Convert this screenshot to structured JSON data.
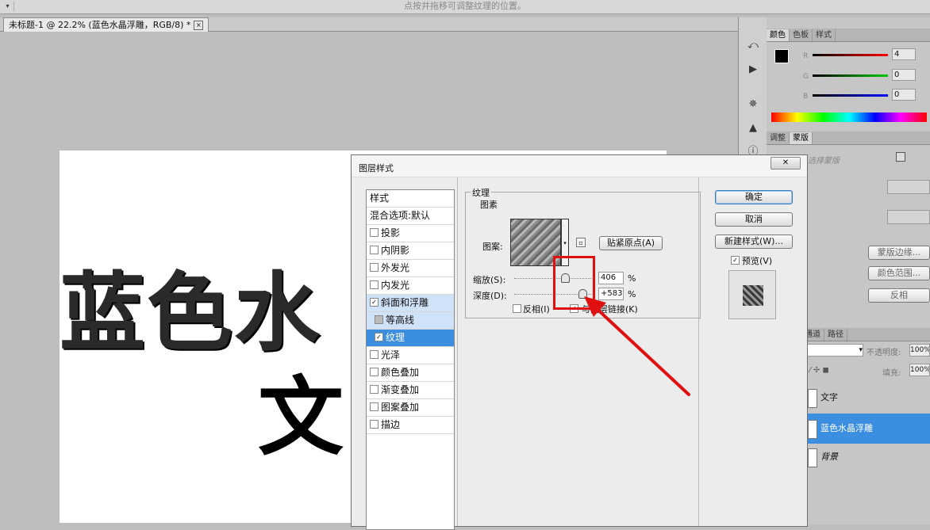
{
  "option_bar": {
    "hint": "点按并拖移可调整纹理的位置。",
    "dropdown_glyph": "▾"
  },
  "document_tab": {
    "title": "未标题-1 @ 22.2% (蓝色水晶浮雕，RGB/8) *",
    "close": "×"
  },
  "canvas": {
    "text_line1": "蓝色水",
    "text_line2": "文"
  },
  "right_panel": {
    "color_tabs": [
      "颜色",
      "色板",
      "样式"
    ],
    "channels": [
      {
        "label": "R",
        "value": "4"
      },
      {
        "label": "G",
        "value": "0"
      },
      {
        "label": "B",
        "value": "0"
      }
    ],
    "adjust_tabs": [
      "调整",
      "蒙版"
    ],
    "mask_hint": "选择蒙版",
    "mask_edge": "蒙版边缘...",
    "color_range": "颜色范围...",
    "invert": "反相",
    "layer_tabs": [
      "通道",
      "路径"
    ],
    "opacity_label": "不透明度:",
    "opacity_value": "100%",
    "fill_label": "填充:",
    "fill_value": "100%",
    "layers": [
      {
        "name": "文字",
        "selected": false
      },
      {
        "name": "蓝色水晶浮雕",
        "selected": true
      },
      {
        "name": "背景",
        "selected": false
      }
    ]
  },
  "dialog": {
    "title": "图层样式",
    "close": "✕",
    "style_items": [
      {
        "label": "样式",
        "check": null
      },
      {
        "label": "混合选项:默认",
        "check": null
      },
      {
        "label": "投影",
        "check": false
      },
      {
        "label": "内阴影",
        "check": false
      },
      {
        "label": "外发光",
        "check": false
      },
      {
        "label": "内发光",
        "check": false
      },
      {
        "label": "斜面和浮雕",
        "check": true
      },
      {
        "label": "等高线",
        "check": false
      },
      {
        "label": "纹理",
        "check": true
      },
      {
        "label": "光泽",
        "check": false
      },
      {
        "label": "颜色叠加",
        "check": false
      },
      {
        "label": "渐变叠加",
        "check": false
      },
      {
        "label": "图案叠加",
        "check": false
      },
      {
        "label": "描边",
        "check": false
      }
    ],
    "section_title": "纹理",
    "group_title": "图素",
    "pattern_label": "图案:",
    "snap_origin": "贴紧原点(A)",
    "scale_label": "缩放(S):",
    "scale_value": "406",
    "depth_label": "深度(D):",
    "depth_value": "+583",
    "percent": "%",
    "invert_label": "反相(I)",
    "link_label": "与图层链接(K)",
    "link_checked": true,
    "ok": "确定",
    "cancel": "取消",
    "new_style": "新建样式(W)...",
    "preview_label": "预览(V)",
    "preview_checked": true
  },
  "annotation_color": "#e01010"
}
